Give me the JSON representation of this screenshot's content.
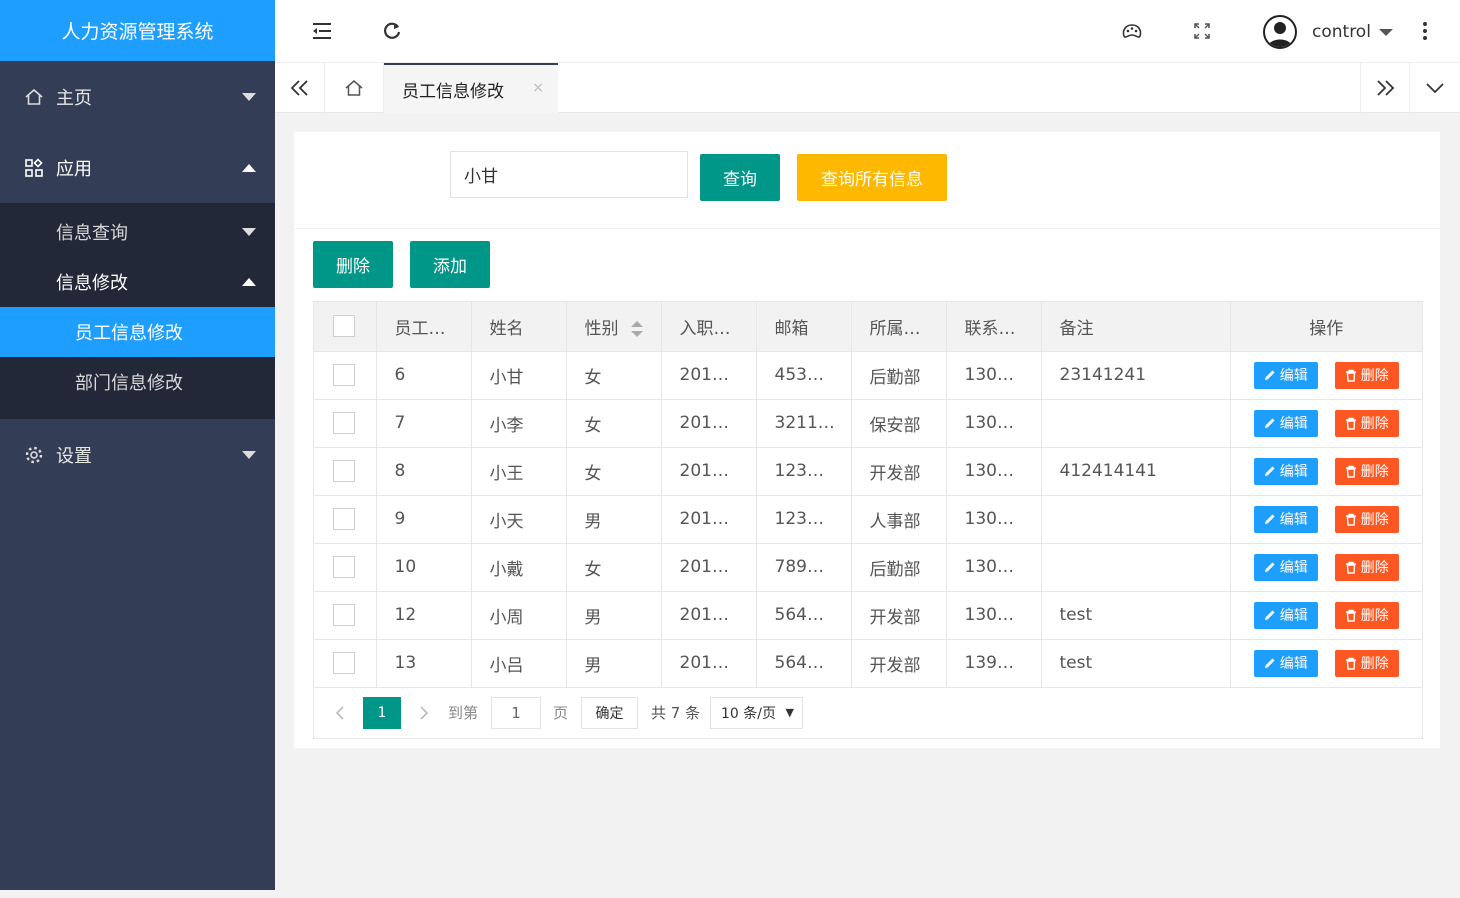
{
  "app": {
    "title": "人力资源管理系统"
  },
  "sidebar": {
    "home": "主页",
    "apps": "应用",
    "info_query": "信息查询",
    "info_edit": "信息修改",
    "employee_edit": "员工信息修改",
    "dept_edit": "部门信息修改",
    "settings": "设置"
  },
  "header": {
    "username": "control"
  },
  "tabs": {
    "active": "员工信息修改",
    "close": "×"
  },
  "search": {
    "value": "小甘",
    "query_btn": "查询",
    "query_all_btn": "查询所有信息"
  },
  "toolbar": {
    "delete_btn": "删除",
    "add_btn": "添加"
  },
  "table": {
    "headers": [
      "员工…",
      "姓名",
      "性别",
      "入职…",
      "邮箱",
      "所属…",
      "联系…",
      "备注",
      "操作"
    ],
    "edit_label": "编辑",
    "delete_label": "删除",
    "rows": [
      [
        "6",
        "小甘",
        "女",
        "201…",
        "453…",
        "后勤部",
        "130…",
        "23141241"
      ],
      [
        "7",
        "小李",
        "女",
        "201…",
        "3211…",
        "保安部",
        "130…",
        ""
      ],
      [
        "8",
        "小王",
        "女",
        "201…",
        "123…",
        "开发部",
        "130…",
        "412414141"
      ],
      [
        "9",
        "小天",
        "男",
        "201…",
        "123…",
        "人事部",
        "130…",
        ""
      ],
      [
        "10",
        "小戴",
        "女",
        "201…",
        "789…",
        "后勤部",
        "130…",
        ""
      ],
      [
        "12",
        "小周",
        "男",
        "201…",
        "564…",
        "开发部",
        "130…",
        "test"
      ],
      [
        "13",
        "小吕",
        "男",
        "201…",
        "564…",
        "开发部",
        "139…",
        "test"
      ]
    ]
  },
  "pagination": {
    "current": "1",
    "goto_label": "到第",
    "goto_value": "1",
    "page_label": "页",
    "confirm": "确定",
    "total": "共 7 条",
    "per_page": "10 条/页"
  },
  "colors": {
    "blue": "#1e9fff",
    "teal": "#009688",
    "yellow": "#ffb800",
    "red": "#ff5722",
    "sidebar": "#343d56"
  }
}
